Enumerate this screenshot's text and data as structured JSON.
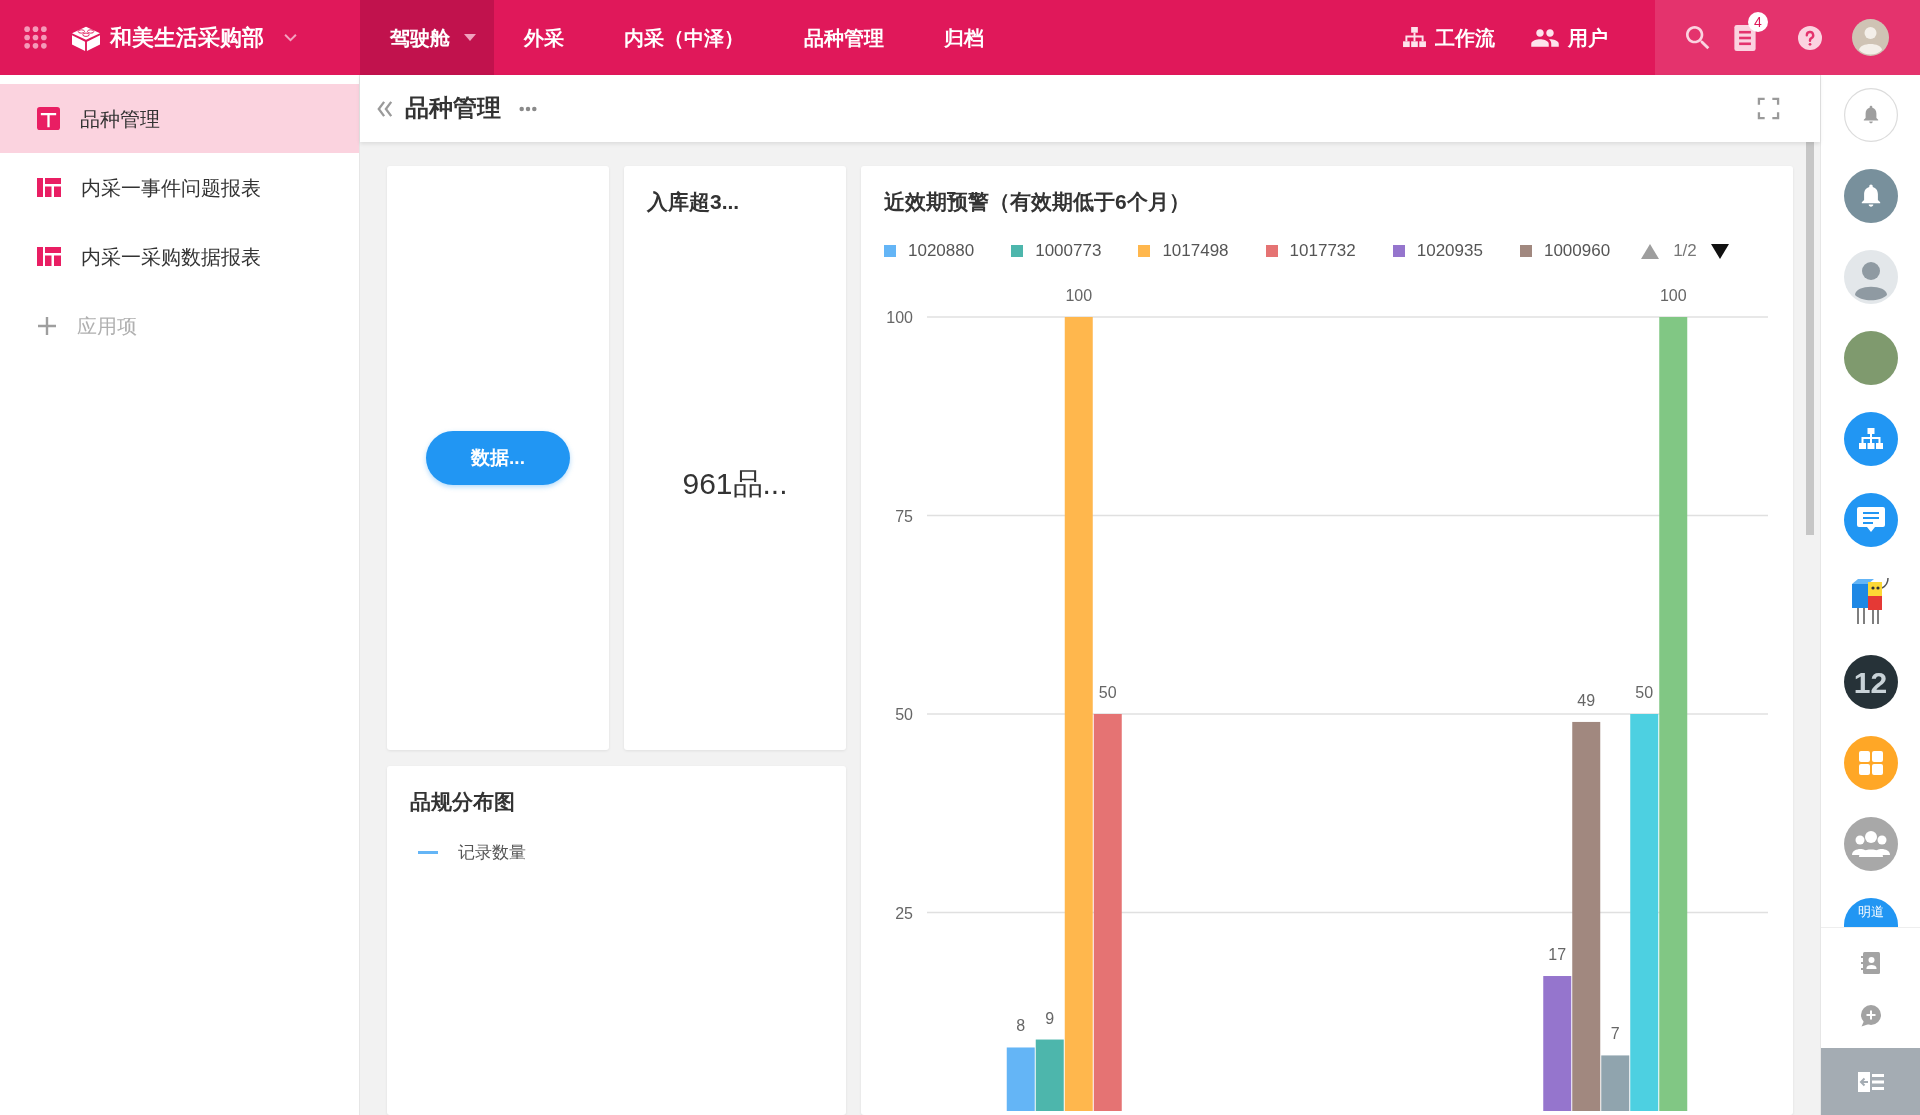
{
  "topbar": {
    "brand": "和美生活采购部",
    "nav": [
      {
        "label": "驾驶舱",
        "selected": true,
        "has_menu": true
      },
      {
        "label": "外采",
        "selected": false,
        "has_menu": false
      },
      {
        "label": "内采（中泽）",
        "selected": false,
        "has_menu": false
      },
      {
        "label": "品种管理",
        "selected": false,
        "has_menu": false
      },
      {
        "label": "归档",
        "selected": false,
        "has_menu": false
      }
    ],
    "links": [
      {
        "kind": "workflow",
        "label": "工作流"
      },
      {
        "kind": "users",
        "label": "用户"
      }
    ],
    "notifications": {
      "count": "4"
    }
  },
  "sidebar": {
    "items": [
      {
        "kind": "page",
        "label": "品种管理",
        "selected": true
      },
      {
        "kind": "report",
        "label": "内采一事件问题报表",
        "selected": false
      },
      {
        "kind": "report",
        "label": "内采一采购数据报表",
        "selected": false
      }
    ],
    "add_label": "应用项"
  },
  "page": {
    "title": "品种管理"
  },
  "widgets": {
    "action_card": {
      "button": "数据..."
    },
    "stat_card": {
      "title": "入库超3...",
      "value": "961品..."
    },
    "expiry_chart": {
      "title": "近效期预警（有效期低于6个月）",
      "legend_pager": {
        "text": "1/2",
        "prev_disabled": true,
        "next_disabled": false
      },
      "chart_data": {
        "type": "bar",
        "series": [
          {
            "name": "1020880",
            "color": "#64b5f6",
            "values": [
              8,
              null
            ]
          },
          {
            "name": "1000773",
            "color": "#4db6ac",
            "values": [
              9,
              null
            ]
          },
          {
            "name": "1017498",
            "color": "#ffb74d",
            "values": [
              100,
              null
            ]
          },
          {
            "name": "1017732",
            "color": "#e57373",
            "values": [
              50,
              null
            ]
          },
          {
            "name": "1020935",
            "color": "#9575cd",
            "values": [
              null,
              17
            ]
          },
          {
            "name": "1000960",
            "color": "#a1887f",
            "values": [
              null,
              49
            ]
          },
          {
            "color": "#90a4ae",
            "values": [
              null,
              7
            ]
          },
          {
            "color": "#4dd0e1",
            "values": [
              null,
              50
            ]
          },
          {
            "color": "#81c784",
            "values": [
              null,
              100
            ]
          }
        ],
        "ylim": [
          0,
          100
        ],
        "yticks": [
          25,
          50,
          75,
          100
        ],
        "grid": true,
        "data_labels": true
      }
    },
    "spec_chart": {
      "title": "品规分布图",
      "legend": [
        {
          "label": "记录数量",
          "color": "#64b5f6"
        }
      ]
    }
  },
  "rail": {
    "items": [
      {
        "kind": "bell_outline"
      },
      {
        "kind": "bell"
      },
      {
        "kind": "person"
      },
      {
        "kind": "photo"
      },
      {
        "kind": "sitemap"
      },
      {
        "kind": "chat"
      },
      {
        "kind": "cartoon"
      },
      {
        "kind": "numeral",
        "text": "12"
      },
      {
        "kind": "grid"
      },
      {
        "kind": "group"
      },
      {
        "kind": "wordmark",
        "text": "明道"
      }
    ]
  }
}
